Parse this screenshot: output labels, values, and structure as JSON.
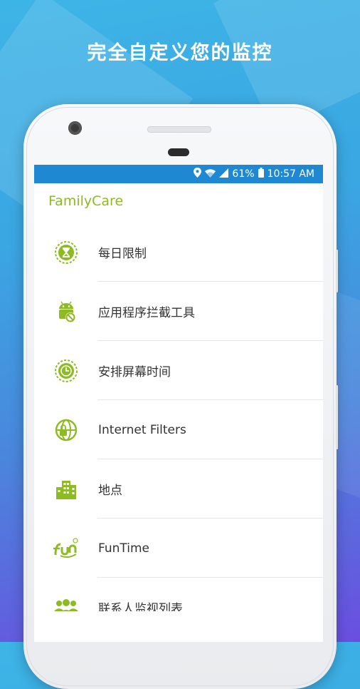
{
  "headline": "完全自定义您的监控",
  "status_bar": {
    "battery": "61%",
    "time": "10:57 AM",
    "icons": [
      "location-icon",
      "wifi-icon",
      "signal-icon",
      "battery-icon"
    ]
  },
  "app": {
    "title": "FamilyCare",
    "menu": [
      {
        "label": "每日限制",
        "icon": "hourglass-icon"
      },
      {
        "label": "应用程序拦截工具",
        "icon": "android-block-icon"
      },
      {
        "label": "安排屏幕时间",
        "icon": "clock-icon"
      },
      {
        "label": "Internet Filters",
        "icon": "globe-lock-icon"
      },
      {
        "label": "地点",
        "icon": "buildings-icon"
      },
      {
        "label": "FunTime",
        "icon": "funtime-logo-icon"
      },
      {
        "label": "联系人监视列表",
        "icon": "people-icon"
      }
    ]
  },
  "colors": {
    "accent": "#8dbb22",
    "status_bar": "#1e88d2",
    "background_top": "#3db4e6",
    "background_bottom": "#6b4ee0"
  }
}
